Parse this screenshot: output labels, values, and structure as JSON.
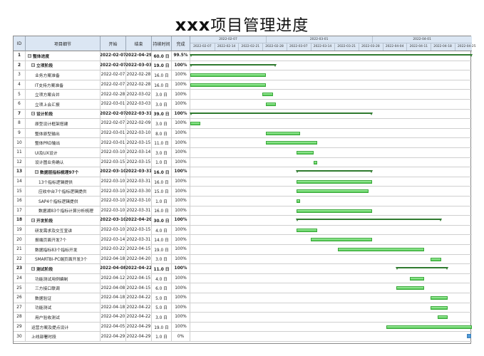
{
  "title": {
    "prefix": "xxx",
    "rest": "项目管理进度"
  },
  "columns": {
    "id": "ID",
    "name": "项目细节",
    "start": "开始",
    "end": "结束",
    "duration": "持续时间",
    "done": "完成"
  },
  "timeline": {
    "months": [
      "2022-02-07",
      "2022-03-01",
      "2022-04-01"
    ],
    "weeks": [
      "2022-02-07",
      "2022-02-14",
      "2022-02-21",
      "2022-02-28",
      "2022-03-07",
      "2022-03-14",
      "2022-03-21",
      "2022-03-28",
      "2022-04-04",
      "2022-04-11",
      "2022-04-18",
      "2022-04-25"
    ],
    "week_trunc": "2022-"
  },
  "rows": [
    {
      "id": "1",
      "name": "整体进度",
      "start": "2022-02-07",
      "end": "2022-04-29",
      "duration": "60.0 日",
      "done": "99.5%",
      "bold": true,
      "level": 0,
      "toggle": "⊟",
      "kind": "summary",
      "s": 0,
      "e": 82
    },
    {
      "id": "2",
      "name": "立项阶段",
      "start": "2022-02-07",
      "end": "2022-03-03",
      "duration": "19.0 日",
      "done": "100%",
      "bold": true,
      "level": 1,
      "toggle": "⊟",
      "kind": "summary",
      "s": 0,
      "e": 25
    },
    {
      "id": "3",
      "name": "业务方案准备",
      "start": "2022-02-07",
      "end": "2022-02-28",
      "duration": "16.0 日",
      "done": "100%",
      "level": 2,
      "kind": "task",
      "s": 0,
      "e": 22
    },
    {
      "id": "4",
      "name": "IT支持方案准备",
      "start": "2022-02-07",
      "end": "2022-02-28",
      "duration": "16.0 日",
      "done": "100%",
      "level": 2,
      "kind": "task",
      "s": 0,
      "e": 22
    },
    {
      "id": "5",
      "name": "立项方案合并",
      "start": "2022-02-28",
      "end": "2022-03-02",
      "duration": "3.0 日",
      "done": "100%",
      "level": 2,
      "kind": "task",
      "s": 21,
      "e": 24
    },
    {
      "id": "6",
      "name": "立项上会汇报",
      "start": "2022-03-01",
      "end": "2022-03-03",
      "duration": "3.0 日",
      "done": "100%",
      "level": 2,
      "kind": "task",
      "s": 22,
      "e": 25
    },
    {
      "id": "7",
      "name": "设计阶段",
      "start": "2022-02-07",
      "end": "2022-03-31",
      "duration": "39.0 日",
      "done": "100%",
      "bold": true,
      "level": 1,
      "toggle": "⊟",
      "kind": "summary",
      "s": 0,
      "e": 53
    },
    {
      "id": "8",
      "name": "原型设计框架搭建",
      "start": "2022-02-07",
      "end": "2022-02-09",
      "duration": "3.0 日",
      "done": "100%",
      "level": 2,
      "kind": "task",
      "s": 0,
      "e": 3
    },
    {
      "id": "9",
      "name": "整体原型输出",
      "start": "2022-03-01",
      "end": "2022-03-10",
      "duration": "8.0 日",
      "done": "100%",
      "level": 2,
      "kind": "task",
      "s": 22,
      "e": 32
    },
    {
      "id": "10",
      "name": "整体PRD输出",
      "start": "2022-03-01",
      "end": "2022-03-15",
      "duration": "11.0 日",
      "done": "100%",
      "level": 2,
      "kind": "task",
      "s": 22,
      "e": 37
    },
    {
      "id": "11",
      "name": "UI及UX设计",
      "start": "2022-03-10",
      "end": "2022-03-14",
      "duration": "3.0 日",
      "done": "100%",
      "level": 2,
      "kind": "task",
      "s": 31,
      "e": 36
    },
    {
      "id": "12",
      "name": "设计图业务确认",
      "start": "2022-03-15",
      "end": "2022-03-15",
      "duration": "1.0 日",
      "done": "100%",
      "level": 2,
      "kind": "task",
      "s": 36,
      "e": 37
    },
    {
      "id": "13",
      "name": "数据层指标梳理97个",
      "start": "2022-03-10",
      "end": "2022-03-31",
      "duration": "16.0 日",
      "done": "100%",
      "bold": true,
      "level": 2,
      "toggle": "⊟",
      "kind": "summary",
      "s": 31,
      "e": 53
    },
    {
      "id": "14",
      "name": "13个指标逻辑提供",
      "start": "2022-03-10",
      "end": "2022-03-31",
      "duration": "16.0 日",
      "done": "100%",
      "level": 3,
      "kind": "task",
      "s": 31,
      "e": 53
    },
    {
      "id": "15",
      "name": "应收中台7个指标逻辑提供",
      "start": "2022-03-10",
      "end": "2022-03-30",
      "duration": "15.0 日",
      "done": "100%",
      "level": 3,
      "kind": "task",
      "s": 31,
      "e": 52
    },
    {
      "id": "16",
      "name": "SAP4个指标逻辑提供",
      "start": "2022-03-10",
      "end": "2022-03-10",
      "duration": "1.0 日",
      "done": "100%",
      "level": 3,
      "kind": "task",
      "s": 31,
      "e": 32
    },
    {
      "id": "17",
      "name": "数据湖83个指标计算分析梳理",
      "start": "2022-03-10",
      "end": "2022-03-31",
      "duration": "16.0 日",
      "done": "100%",
      "level": 3,
      "kind": "task",
      "s": 31,
      "e": 53
    },
    {
      "id": "18",
      "name": "开发阶段",
      "start": "2022-03-10",
      "end": "2022-04-20",
      "duration": "30.0 日",
      "done": "100%",
      "bold": true,
      "level": 1,
      "toggle": "⊟",
      "kind": "summary",
      "s": 31,
      "e": 73
    },
    {
      "id": "19",
      "name": "研发需求及交互宣讲",
      "start": "2022-03-10",
      "end": "2022-03-15",
      "duration": "4.0 日",
      "done": "100%",
      "level": 2,
      "kind": "task",
      "s": 31,
      "e": 37
    },
    {
      "id": "20",
      "name": "报端页面开发7个",
      "start": "2022-03-14",
      "end": "2022-03-31",
      "duration": "14.0 日",
      "done": "100%",
      "level": 2,
      "kind": "task",
      "s": 35,
      "e": 53
    },
    {
      "id": "21",
      "name": "数据指标83个指标开发",
      "start": "2022-03-22",
      "end": "2022-04-15",
      "duration": "19.0 日",
      "done": "100%",
      "level": 2,
      "kind": "task",
      "s": 43,
      "e": 68
    },
    {
      "id": "22",
      "name": "SMARTBI-PC端页面开发3个",
      "start": "2022-04-18",
      "end": "2022-04-20",
      "duration": "3.0 日",
      "done": "100%",
      "level": 2,
      "kind": "task",
      "s": 70,
      "e": 73
    },
    {
      "id": "23",
      "name": "测试阶段",
      "start": "2022-04-08",
      "end": "2022-04-22",
      "duration": "11.0 日",
      "done": "100%",
      "bold": true,
      "level": 1,
      "toggle": "⊟",
      "kind": "summary",
      "s": 60,
      "e": 75
    },
    {
      "id": "24",
      "name": "功能测试用例编制",
      "start": "2022-04-12",
      "end": "2022-04-15",
      "duration": "4.0 日",
      "done": "100%",
      "level": 2,
      "kind": "task",
      "s": 64,
      "e": 68
    },
    {
      "id": "25",
      "name": "三方接口联调",
      "start": "2022-04-08",
      "end": "2022-04-15",
      "duration": "6.0 日",
      "done": "100%",
      "level": 2,
      "kind": "task",
      "s": 60,
      "e": 68
    },
    {
      "id": "26",
      "name": "数据验证",
      "start": "2022-04-18",
      "end": "2022-04-22",
      "duration": "5.0 日",
      "done": "100%",
      "level": 2,
      "kind": "task",
      "s": 70,
      "e": 75
    },
    {
      "id": "27",
      "name": "功能测试",
      "start": "2022-04-18",
      "end": "2022-04-22",
      "duration": "5.0 日",
      "done": "100%",
      "level": 2,
      "kind": "task",
      "s": 70,
      "e": 75
    },
    {
      "id": "28",
      "name": "用户验收测试",
      "start": "2022-04-20",
      "end": "2022-04-22",
      "duration": "3.0 日",
      "done": "100%",
      "level": 2,
      "kind": "task",
      "s": 72,
      "e": 75
    },
    {
      "id": "29",
      "name": "运营方案及提点设计",
      "start": "2022-04-05",
      "end": "2022-04-29",
      "duration": "19.0 日",
      "done": "100%",
      "level": 1,
      "kind": "task",
      "s": 57,
      "e": 82
    },
    {
      "id": "30",
      "name": "上线部署时段",
      "start": "2022-04-29",
      "end": "2022-04-29",
      "duration": "1.0 日",
      "done": "0%",
      "level": 1,
      "kind": "todo",
      "s": 81,
      "e": 82
    }
  ]
}
